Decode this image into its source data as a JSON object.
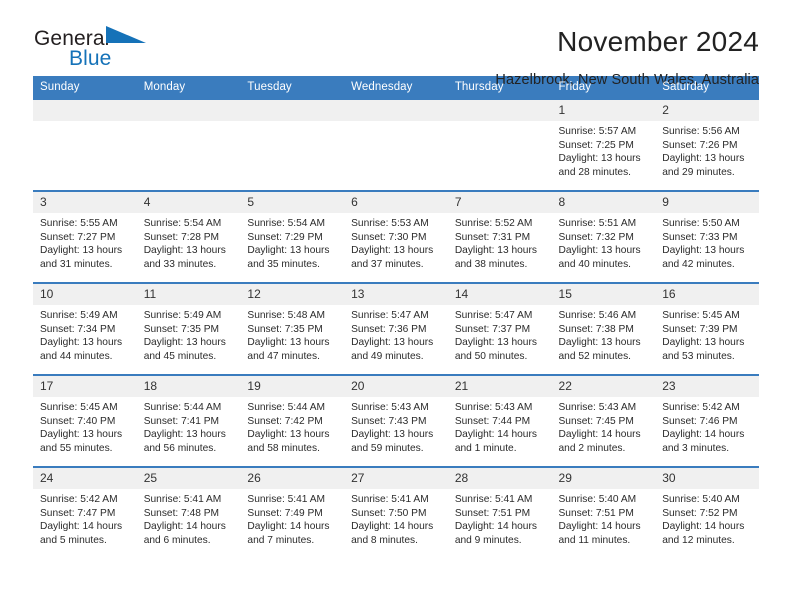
{
  "brand": {
    "line1": "General",
    "line2": "Blue",
    "flag_icon": "blue-triangle-flag-icon"
  },
  "header": {
    "title": "November 2024",
    "location": "Hazelbrook, New South Wales, Australia"
  },
  "colors": {
    "header_blue": "#3a7cbe",
    "daynum_bg": "#f0f0f0",
    "brand_blue": "#1572b8",
    "text": "#222222"
  },
  "weekdays": [
    "Sunday",
    "Monday",
    "Tuesday",
    "Wednesday",
    "Thursday",
    "Friday",
    "Saturday"
  ],
  "weeks": [
    [
      {
        "day": "",
        "sunrise": "",
        "sunset": "",
        "daylight": "",
        "daylight2": ""
      },
      {
        "day": "",
        "sunrise": "",
        "sunset": "",
        "daylight": "",
        "daylight2": ""
      },
      {
        "day": "",
        "sunrise": "",
        "sunset": "",
        "daylight": "",
        "daylight2": ""
      },
      {
        "day": "",
        "sunrise": "",
        "sunset": "",
        "daylight": "",
        "daylight2": ""
      },
      {
        "day": "",
        "sunrise": "",
        "sunset": "",
        "daylight": "",
        "daylight2": ""
      },
      {
        "day": "1",
        "sunrise": "Sunrise: 5:57 AM",
        "sunset": "Sunset: 7:25 PM",
        "daylight": "Daylight: 13 hours",
        "daylight2": "and 28 minutes."
      },
      {
        "day": "2",
        "sunrise": "Sunrise: 5:56 AM",
        "sunset": "Sunset: 7:26 PM",
        "daylight": "Daylight: 13 hours",
        "daylight2": "and 29 minutes."
      }
    ],
    [
      {
        "day": "3",
        "sunrise": "Sunrise: 5:55 AM",
        "sunset": "Sunset: 7:27 PM",
        "daylight": "Daylight: 13 hours",
        "daylight2": "and 31 minutes."
      },
      {
        "day": "4",
        "sunrise": "Sunrise: 5:54 AM",
        "sunset": "Sunset: 7:28 PM",
        "daylight": "Daylight: 13 hours",
        "daylight2": "and 33 minutes."
      },
      {
        "day": "5",
        "sunrise": "Sunrise: 5:54 AM",
        "sunset": "Sunset: 7:29 PM",
        "daylight": "Daylight: 13 hours",
        "daylight2": "and 35 minutes."
      },
      {
        "day": "6",
        "sunrise": "Sunrise: 5:53 AM",
        "sunset": "Sunset: 7:30 PM",
        "daylight": "Daylight: 13 hours",
        "daylight2": "and 37 minutes."
      },
      {
        "day": "7",
        "sunrise": "Sunrise: 5:52 AM",
        "sunset": "Sunset: 7:31 PM",
        "daylight": "Daylight: 13 hours",
        "daylight2": "and 38 minutes."
      },
      {
        "day": "8",
        "sunrise": "Sunrise: 5:51 AM",
        "sunset": "Sunset: 7:32 PM",
        "daylight": "Daylight: 13 hours",
        "daylight2": "and 40 minutes."
      },
      {
        "day": "9",
        "sunrise": "Sunrise: 5:50 AM",
        "sunset": "Sunset: 7:33 PM",
        "daylight": "Daylight: 13 hours",
        "daylight2": "and 42 minutes."
      }
    ],
    [
      {
        "day": "10",
        "sunrise": "Sunrise: 5:49 AM",
        "sunset": "Sunset: 7:34 PM",
        "daylight": "Daylight: 13 hours",
        "daylight2": "and 44 minutes."
      },
      {
        "day": "11",
        "sunrise": "Sunrise: 5:49 AM",
        "sunset": "Sunset: 7:35 PM",
        "daylight": "Daylight: 13 hours",
        "daylight2": "and 45 minutes."
      },
      {
        "day": "12",
        "sunrise": "Sunrise: 5:48 AM",
        "sunset": "Sunset: 7:35 PM",
        "daylight": "Daylight: 13 hours",
        "daylight2": "and 47 minutes."
      },
      {
        "day": "13",
        "sunrise": "Sunrise: 5:47 AM",
        "sunset": "Sunset: 7:36 PM",
        "daylight": "Daylight: 13 hours",
        "daylight2": "and 49 minutes."
      },
      {
        "day": "14",
        "sunrise": "Sunrise: 5:47 AM",
        "sunset": "Sunset: 7:37 PM",
        "daylight": "Daylight: 13 hours",
        "daylight2": "and 50 minutes."
      },
      {
        "day": "15",
        "sunrise": "Sunrise: 5:46 AM",
        "sunset": "Sunset: 7:38 PM",
        "daylight": "Daylight: 13 hours",
        "daylight2": "and 52 minutes."
      },
      {
        "day": "16",
        "sunrise": "Sunrise: 5:45 AM",
        "sunset": "Sunset: 7:39 PM",
        "daylight": "Daylight: 13 hours",
        "daylight2": "and 53 minutes."
      }
    ],
    [
      {
        "day": "17",
        "sunrise": "Sunrise: 5:45 AM",
        "sunset": "Sunset: 7:40 PM",
        "daylight": "Daylight: 13 hours",
        "daylight2": "and 55 minutes."
      },
      {
        "day": "18",
        "sunrise": "Sunrise: 5:44 AM",
        "sunset": "Sunset: 7:41 PM",
        "daylight": "Daylight: 13 hours",
        "daylight2": "and 56 minutes."
      },
      {
        "day": "19",
        "sunrise": "Sunrise: 5:44 AM",
        "sunset": "Sunset: 7:42 PM",
        "daylight": "Daylight: 13 hours",
        "daylight2": "and 58 minutes."
      },
      {
        "day": "20",
        "sunrise": "Sunrise: 5:43 AM",
        "sunset": "Sunset: 7:43 PM",
        "daylight": "Daylight: 13 hours",
        "daylight2": "and 59 minutes."
      },
      {
        "day": "21",
        "sunrise": "Sunrise: 5:43 AM",
        "sunset": "Sunset: 7:44 PM",
        "daylight": "Daylight: 14 hours",
        "daylight2": "and 1 minute."
      },
      {
        "day": "22",
        "sunrise": "Sunrise: 5:43 AM",
        "sunset": "Sunset: 7:45 PM",
        "daylight": "Daylight: 14 hours",
        "daylight2": "and 2 minutes."
      },
      {
        "day": "23",
        "sunrise": "Sunrise: 5:42 AM",
        "sunset": "Sunset: 7:46 PM",
        "daylight": "Daylight: 14 hours",
        "daylight2": "and 3 minutes."
      }
    ],
    [
      {
        "day": "24",
        "sunrise": "Sunrise: 5:42 AM",
        "sunset": "Sunset: 7:47 PM",
        "daylight": "Daylight: 14 hours",
        "daylight2": "and 5 minutes."
      },
      {
        "day": "25",
        "sunrise": "Sunrise: 5:41 AM",
        "sunset": "Sunset: 7:48 PM",
        "daylight": "Daylight: 14 hours",
        "daylight2": "and 6 minutes."
      },
      {
        "day": "26",
        "sunrise": "Sunrise: 5:41 AM",
        "sunset": "Sunset: 7:49 PM",
        "daylight": "Daylight: 14 hours",
        "daylight2": "and 7 minutes."
      },
      {
        "day": "27",
        "sunrise": "Sunrise: 5:41 AM",
        "sunset": "Sunset: 7:50 PM",
        "daylight": "Daylight: 14 hours",
        "daylight2": "and 8 minutes."
      },
      {
        "day": "28",
        "sunrise": "Sunrise: 5:41 AM",
        "sunset": "Sunset: 7:51 PM",
        "daylight": "Daylight: 14 hours",
        "daylight2": "and 9 minutes."
      },
      {
        "day": "29",
        "sunrise": "Sunrise: 5:40 AM",
        "sunset": "Sunset: 7:51 PM",
        "daylight": "Daylight: 14 hours",
        "daylight2": "and 11 minutes."
      },
      {
        "day": "30",
        "sunrise": "Sunrise: 5:40 AM",
        "sunset": "Sunset: 7:52 PM",
        "daylight": "Daylight: 14 hours",
        "daylight2": "and 12 minutes."
      }
    ]
  ]
}
